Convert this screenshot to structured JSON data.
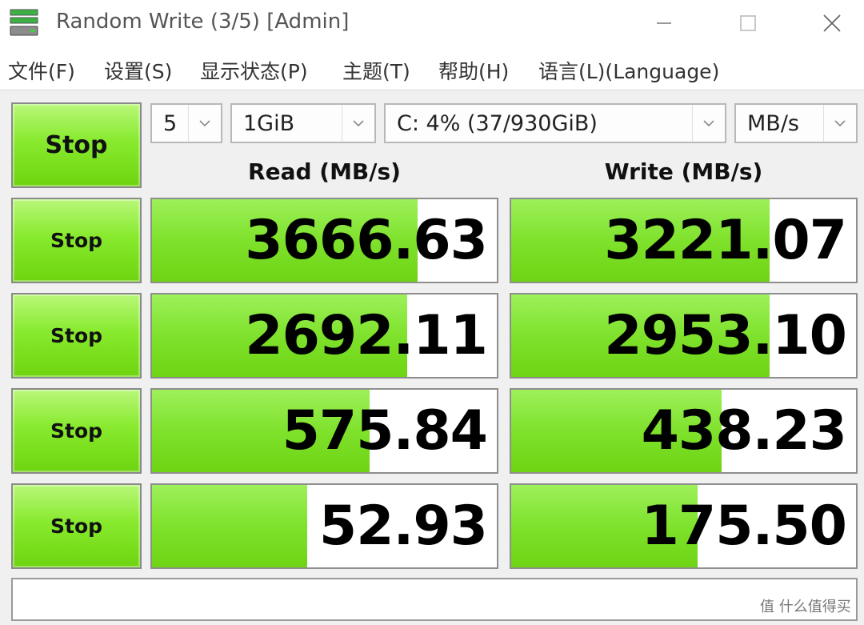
{
  "window": {
    "title": "Random Write (3/5) [Admin]",
    "icon": "app-disk-icon"
  },
  "menu": [
    "文件(F)",
    "设置(S)",
    "显示状态(P)",
    "主题(T)",
    "帮助(H)",
    "语言(L)(Language)"
  ],
  "controls": {
    "main_button": "Stop",
    "count": "5",
    "size": "1GiB",
    "drive": "C: 4% (37/930GiB)",
    "unit": "MB/s"
  },
  "headers": {
    "read": "Read (MB/s)",
    "write": "Write (MB/s)"
  },
  "rows": [
    {
      "button": "Stop",
      "read": "3666.63",
      "read_fill": 0.77,
      "write": "3221.07",
      "write_fill": 0.75
    },
    {
      "button": "Stop",
      "read": "2692.11",
      "read_fill": 0.74,
      "write": "2953.10",
      "write_fill": 0.75
    },
    {
      "button": "Stop",
      "read": "575.84",
      "read_fill": 0.63,
      "write": "438.23",
      "write_fill": 0.61
    },
    {
      "button": "Stop",
      "read": "52.93",
      "read_fill": 0.45,
      "write": "175.50",
      "write_fill": 0.54
    }
  ],
  "status": "",
  "colors": {
    "accent_green": "#7fe22c",
    "window_bg": "#f0f0f0"
  },
  "watermark": "值 什么值得买"
}
